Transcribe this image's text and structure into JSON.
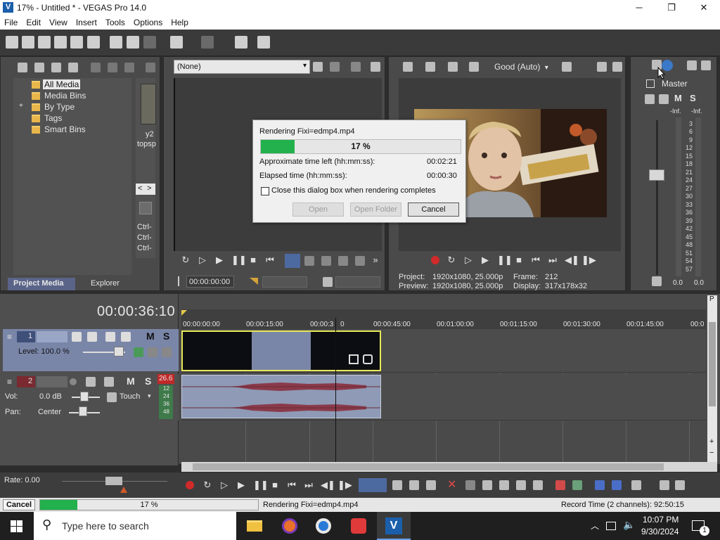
{
  "window": {
    "title": "17% - Untitled * - VEGAS Pro 14.0",
    "minimize": "─",
    "maximize": "❐",
    "close": "✕"
  },
  "menu": [
    "File",
    "Edit",
    "View",
    "Insert",
    "Tools",
    "Options",
    "Help"
  ],
  "project_media": {
    "tree": [
      "All Media",
      "Media Bins",
      "By Type",
      "Tags",
      "Smart Bins"
    ],
    "expander": "+",
    "thumb_caption_1": "y2",
    "thumb_caption_2": "topsp",
    "nav_left": "<",
    "nav_right": ">",
    "ctrl_lines": [
      "Ctrl-",
      "Ctrl-",
      "Ctrl-"
    ],
    "tabs": [
      "Project Media",
      "Explorer"
    ]
  },
  "trimmer": {
    "preset": "(None)",
    "timecode": "00:00:00:00"
  },
  "preview": {
    "quality": "Good (Auto)",
    "project_label": "Project:",
    "project_value": "1920x1080, 25.000p",
    "preview_label": "Preview:",
    "preview_value": "1920x1080, 25.000p",
    "frame_label": "Frame:",
    "frame_value": "212",
    "display_label": "Display:",
    "display_value": "317x178x32"
  },
  "master": {
    "title": "Master",
    "m": "M",
    "s": "S",
    "inf_left": "-Inf.",
    "inf_right": "-Inf.",
    "scale": [
      "3",
      "6",
      "9",
      "12",
      "15",
      "18",
      "21",
      "24",
      "27",
      "30",
      "33",
      "36",
      "39",
      "42",
      "45",
      "48",
      "51",
      "54",
      "57"
    ],
    "bottom_left": "0.0",
    "bottom_right": "0.0"
  },
  "dialog": {
    "title": "Rendering Fixi=edmp4.mp4",
    "progress_text": "17 %",
    "progress": 0.17,
    "time_left_label": "Approximate time left (hh:mm:ss):",
    "time_left_value": "00:02:21",
    "elapsed_label": "Elapsed time (hh:mm:ss):",
    "elapsed_value": "00:00:30",
    "checkbox_label": "Close this dialog box when rendering completes",
    "open": "Open",
    "open_folder": "Open Folder",
    "cancel": "Cancel"
  },
  "timeline": {
    "timecode": "00:00:36:10",
    "ruler": [
      "00:00:00:00",
      "00:00:15:00",
      "00:00:3",
      "0",
      "00:00:45:00",
      "00:01:00:00",
      "00:01:15:00",
      "00:01:30:00",
      "00:01:45:00",
      "00:0"
    ],
    "video_track": {
      "number": "1",
      "m": "M",
      "s": "S",
      "level_label": "Level: 100.0 %"
    },
    "audio_track": {
      "number": "2",
      "m": "M",
      "s": "S",
      "vol_label": "Vol:",
      "vol_value": "0.0 dB",
      "pan_label": "Pan:",
      "pan_value": "Center",
      "touch": "Touch",
      "peak": "26.6",
      "meter_marks": [
        "12",
        "24",
        "36",
        "48"
      ]
    },
    "rate": "Rate: 0.00",
    "scroll_p": "P",
    "scroll_controls": [
      "+",
      "−"
    ]
  },
  "status": {
    "cancel": "Cancel",
    "progress_text": "17 %",
    "progress": 0.17,
    "rendering": "Rendering Fixi=edmp4.mp4",
    "record_time": "Record Time (2 channels): 92:50:15"
  },
  "taskbar": {
    "search_placeholder": "Type here to search",
    "time": "10:07 PM",
    "date": "9/30/2024",
    "notification_count": "1"
  },
  "colors": {
    "accent_green": "#22b14c",
    "clip_highlight": "#e8e85a",
    "audio_wave": "#8a3a4a",
    "selection_blue": "#7a86a8"
  }
}
